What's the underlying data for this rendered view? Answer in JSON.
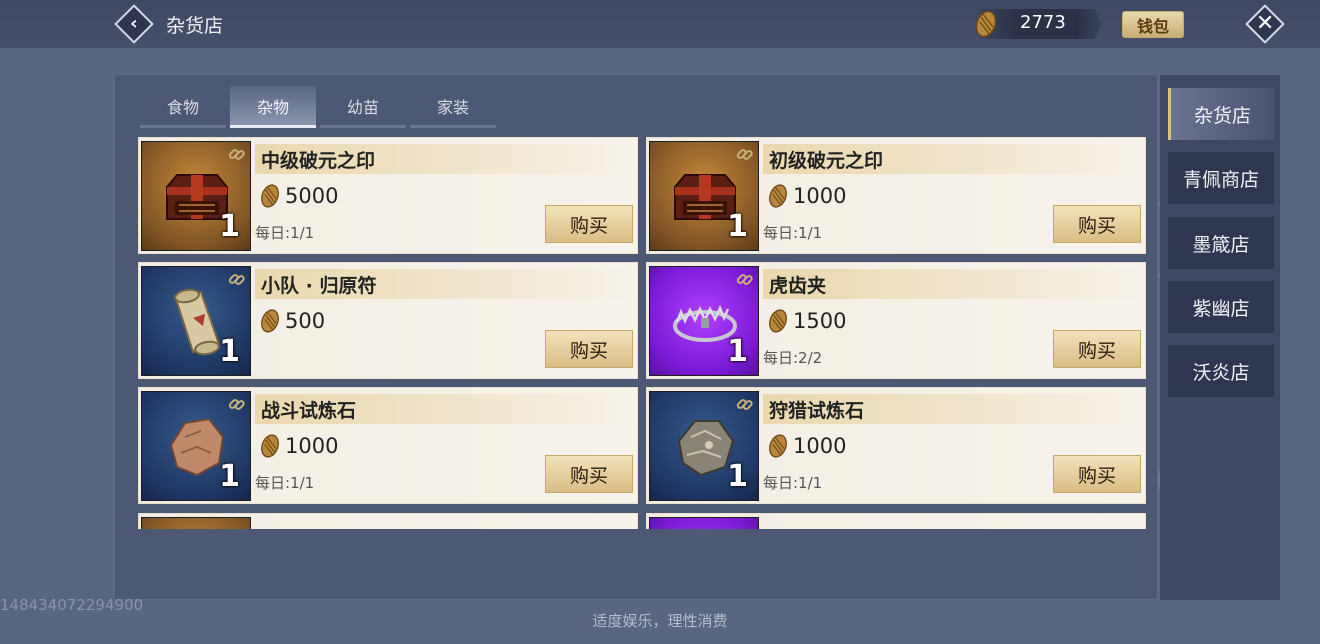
{
  "header": {
    "title": "杂货店",
    "currency_value": "2773",
    "wallet_label": "钱包"
  },
  "tabs": [
    {
      "label": "食物",
      "active": false
    },
    {
      "label": "杂物",
      "active": true
    },
    {
      "label": "幼苗",
      "active": false
    },
    {
      "label": "家装",
      "active": false
    }
  ],
  "items": [
    {
      "name": "中级破元之印",
      "price": "5000",
      "daily": "每日:1/1",
      "qty": "1",
      "buy_label": "购买",
      "icon": "chest-icon",
      "frame": "orange"
    },
    {
      "name": "初级破元之印",
      "price": "1000",
      "daily": "每日:1/1",
      "qty": "1",
      "buy_label": "购买",
      "icon": "chest-icon",
      "frame": "orange"
    },
    {
      "name": "小队 · 归原符",
      "price": "500",
      "daily": "",
      "qty": "1",
      "buy_label": "购买",
      "icon": "scroll-icon",
      "frame": "blue"
    },
    {
      "name": "虎齿夹",
      "price": "1500",
      "daily": "每日:2/2",
      "qty": "1",
      "buy_label": "购买",
      "icon": "trap-icon",
      "frame": "purple"
    },
    {
      "name": "战斗试炼石",
      "price": "1000",
      "daily": "每日:1/1",
      "qty": "1",
      "buy_label": "购买",
      "icon": "stone-icon",
      "frame": "blue"
    },
    {
      "name": "狩猎试炼石",
      "price": "1000",
      "daily": "每日:1/1",
      "qty": "1",
      "buy_label": "购买",
      "icon": "stone-icon",
      "frame": "blue"
    }
  ],
  "side_nav": [
    {
      "label": "杂货店",
      "active": true
    },
    {
      "label": "青佩商店",
      "active": false
    },
    {
      "label": "墨箴店",
      "active": false
    },
    {
      "label": "紫幽店",
      "active": false
    },
    {
      "label": "沃炎店",
      "active": false
    }
  ],
  "watermark": "148434072294900",
  "footer": "适度娱乐，理性消费",
  "colors": {
    "frame_orange": "#9a6a2e",
    "frame_blue": "#1d3560",
    "frame_purple": "#7a1ad4",
    "buy_button": "#e6cf9d",
    "active_tab_accent": "#d9c47e"
  }
}
